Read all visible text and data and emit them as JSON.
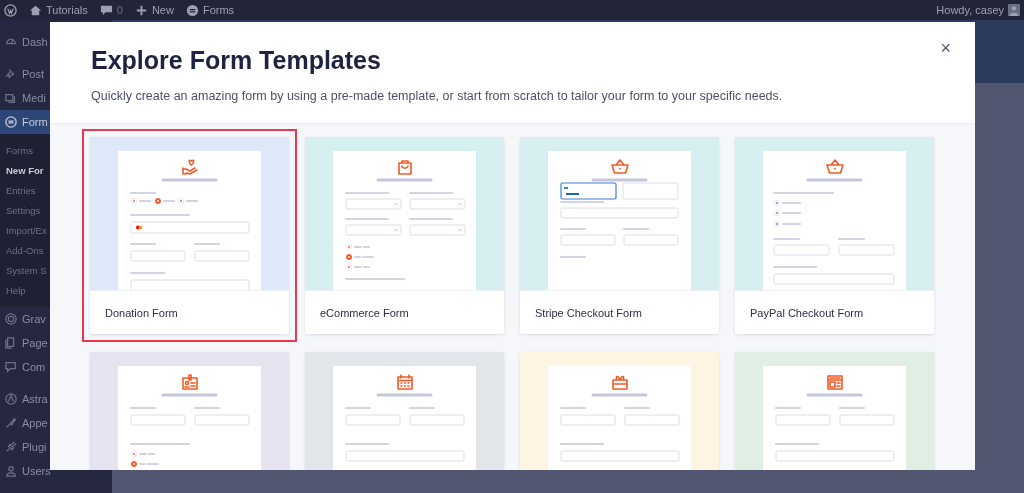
{
  "admin_bar": {
    "site": "Tutorials",
    "comments": "0",
    "new": "New",
    "forms": "Forms",
    "greeting": "Howdy, casey"
  },
  "sidebar": {
    "groups": [
      [
        {
          "label": "Dash",
          "selected": false
        }
      ],
      [
        {
          "label": "Post",
          "selected": false
        },
        {
          "label": "Medi",
          "selected": false
        },
        {
          "label": "Form",
          "selected": true,
          "children": [
            {
              "label": "Forms",
              "selected": false
            },
            {
              "label": "New For",
              "selected": true
            },
            {
              "label": "Entries",
              "selected": false
            },
            {
              "label": "Settings",
              "selected": false
            },
            {
              "label": "Import/Ex",
              "selected": false
            },
            {
              "label": "Add-Ons",
              "selected": false
            },
            {
              "label": "System S",
              "selected": false
            },
            {
              "label": "Help",
              "selected": false
            }
          ]
        },
        {
          "label": "Grav",
          "selected": false
        },
        {
          "label": "Page",
          "selected": false
        },
        {
          "label": "Com",
          "selected": false
        }
      ],
      [
        {
          "label": "Astra",
          "selected": false
        },
        {
          "label": "Appe",
          "selected": false
        },
        {
          "label": "Plugi",
          "selected": false
        },
        {
          "label": "Users",
          "selected": false
        }
      ]
    ]
  },
  "modal": {
    "title": "Explore Form Templates",
    "subtitle": "Quickly create an amazing form by using a pre-made template, or start from scratch to tailor your form to your specific needs.",
    "close": "×",
    "templates": [
      {
        "kind": "donation",
        "label": "Donation Form",
        "color": "#dde8f8",
        "selected": true
      },
      {
        "kind": "ecommerce",
        "label": "eCommerce Form",
        "color": "#d6eff1",
        "selected": false
      },
      {
        "kind": "stripe",
        "label": "Stripe Checkout Form",
        "color": "#d7eff1",
        "selected": false
      },
      {
        "kind": "paypal",
        "label": "PayPal Checkout Form",
        "color": "#d7eff1",
        "selected": false
      },
      {
        "kind": "badge",
        "color": "#e6e3f1",
        "selected": false
      },
      {
        "kind": "calendar",
        "color": "#e2e6ea",
        "selected": false
      },
      {
        "kind": "gift",
        "color": "#fdf5e2",
        "selected": false
      },
      {
        "kind": "layout",
        "color": "#e0efe3",
        "selected": false
      }
    ]
  }
}
